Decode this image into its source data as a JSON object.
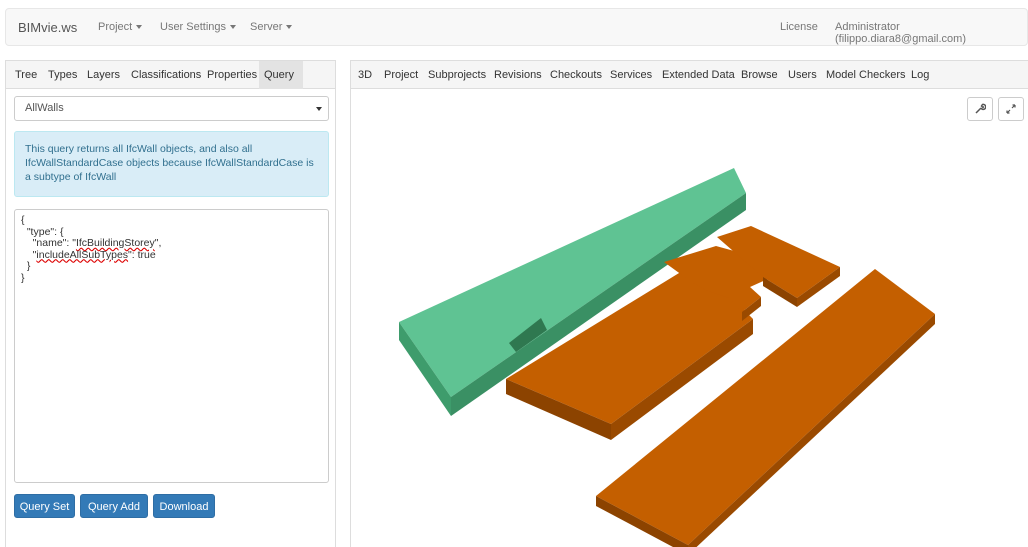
{
  "navbar": {
    "brand": "BIMvie.ws",
    "menus": [
      "Project",
      "User Settings",
      "Server"
    ],
    "license": "License",
    "user": "Administrator (filippo.diara8@gmail.com)"
  },
  "left": {
    "tabs": [
      "Tree",
      "Types",
      "Layers",
      "Classifications",
      "Properties",
      "Query"
    ],
    "active_tab": "Query",
    "query_select": "AllWalls",
    "info_text": "This query returns all IfcWall objects, and also all IfcWallStandardCase objects because IfcWallStandardCase is a subtype of IfcWall",
    "editor": {
      "l1": "{",
      "l2": "  \"type\": {",
      "l3_a": "    \"name\": \"",
      "l3_b": "IfcBuildingStorey",
      "l3_c": "\",",
      "l4_a": "    \"",
      "l4_b": "includeAllSubTypes",
      "l4_c": "\": true",
      "l5": "  }",
      "l6": "}"
    },
    "buttons": {
      "query_set": "Query Set",
      "query_add": "Query Add",
      "download": "Download"
    }
  },
  "right": {
    "tabs": [
      "3D",
      "Project",
      "Subprojects",
      "Revisions",
      "Checkouts",
      "Services",
      "Extended Data",
      "Browse",
      "Users",
      "Model Checkers",
      "Log"
    ],
    "active_tab": "3D",
    "tools": {
      "settings": "wrench-icon",
      "fullscreen": "expand-icon"
    }
  },
  "colors": {
    "brand_blue": "#337ab7",
    "info_bg": "#d9edf7",
    "model_green": "#5fc393",
    "model_orange": "#c45f00"
  }
}
